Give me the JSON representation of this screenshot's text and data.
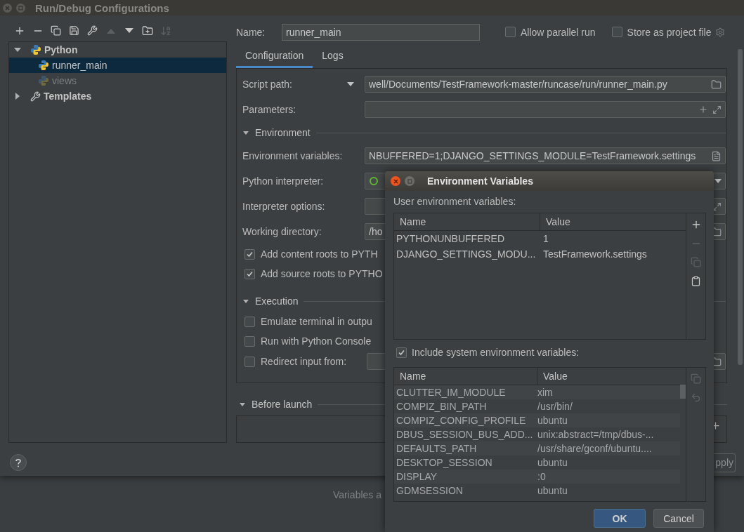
{
  "window": {
    "title": "Run/Debug Configurations"
  },
  "toolbar": [
    {
      "kind": "add",
      "disabled": false
    },
    {
      "kind": "remove",
      "disabled": false
    },
    {
      "kind": "copy",
      "disabled": false
    },
    {
      "kind": "save",
      "disabled": false
    },
    {
      "kind": "edit",
      "disabled": false
    },
    {
      "kind": "up",
      "disabled": true
    },
    {
      "kind": "down",
      "disabled": false
    },
    {
      "kind": "folder",
      "disabled": false
    },
    {
      "kind": "sort",
      "disabled": true
    }
  ],
  "tree": [
    {
      "label": "Python",
      "kind": "python",
      "expanded": true,
      "selected": false,
      "children": [
        {
          "label": "runner_main",
          "kind": "python",
          "selected": true,
          "dimmed": false
        },
        {
          "label": "views",
          "kind": "python",
          "selected": false,
          "dimmed": true
        }
      ]
    },
    {
      "label": "Templates",
      "kind": "templates",
      "expanded": false,
      "selected": false
    }
  ],
  "name_field": {
    "label": "Name:",
    "value": "runner_main"
  },
  "options": [
    {
      "label": "Allow parallel run",
      "checked": false
    },
    {
      "label": "Store as project file",
      "checked": false
    }
  ],
  "tabs": [
    {
      "label": "Configuration",
      "selected": true
    },
    {
      "label": "Logs",
      "selected": false
    }
  ],
  "config_rows": [
    {
      "kind": "path_field",
      "label": "Script path:",
      "dropdown": true,
      "value": "well/Documents/TestFramework-master/runcase/run/runner_main.py"
    },
    {
      "kind": "param_field",
      "label": "Parameters:"
    },
    {
      "kind": "section",
      "label": "Environment"
    },
    {
      "kind": "env_field",
      "label": "Environment variables:",
      "value": "NBUFFERED=1;DJANGO_SETTINGS_MODULE=TestFramework.settings"
    },
    {
      "kind": "combo",
      "label": "Python interpreter:"
    },
    {
      "kind": "options_field",
      "label": "Interpreter options:"
    },
    {
      "kind": "path_field",
      "label": "Working directory:",
      "value": "/ho"
    },
    {
      "kind": "checkbox",
      "label": "Add content roots to PYTH",
      "checked": true
    },
    {
      "kind": "checkbox",
      "label": "Add source roots to PYTHO",
      "checked": true
    },
    {
      "kind": "section",
      "label": "Execution"
    },
    {
      "kind": "checkbox",
      "label": "Emulate terminal in outpu",
      "checked": false
    },
    {
      "kind": "checkbox",
      "label": "Run with Python Console",
      "checked": false
    },
    {
      "kind": "checkbox_field",
      "label": "Redirect input from:",
      "checked": false
    }
  ],
  "before_launch": {
    "label": "Before launch"
  },
  "footer": {
    "apply_label": "pply"
  },
  "background_text": "Variables a",
  "dialog": {
    "title": "Environment Variables",
    "user_label": "User environment variables:",
    "user_columns": [
      "Name",
      "Value"
    ],
    "user_rows": [
      [
        "PYTHONUNBUFFERED",
        "1"
      ],
      [
        "DJANGO_SETTINGS_MODU...",
        "TestFramework.settings"
      ]
    ],
    "user_tools": [
      {
        "kind": "add",
        "disabled": false
      },
      {
        "kind": "remove",
        "disabled": true
      },
      {
        "kind": "copy",
        "disabled": true
      },
      {
        "kind": "paste",
        "disabled": false
      }
    ],
    "include_system": {
      "label": "Include system environment variables:",
      "checked": true
    },
    "system_columns": [
      "Name",
      "Value"
    ],
    "system_rows": [
      [
        "CLUTTER_IM_MODULE",
        "xim"
      ],
      [
        "COMPIZ_BIN_PATH",
        "/usr/bin/"
      ],
      [
        "COMPIZ_CONFIG_PROFILE",
        "ubuntu"
      ],
      [
        "DBUS_SESSION_BUS_ADD...",
        "unix:abstract=/tmp/dbus-..."
      ],
      [
        "DEFAULTS_PATH",
        "/usr/share/gconf/ubuntu...."
      ],
      [
        "DESKTOP_SESSION",
        "ubuntu"
      ],
      [
        "DISPLAY",
        ":0"
      ],
      [
        "GDMSESSION",
        "ubuntu"
      ]
    ],
    "system_tools": [
      {
        "kind": "copy",
        "disabled": true
      },
      {
        "kind": "undo",
        "disabled": true
      }
    ],
    "buttons": [
      {
        "label": "OK",
        "kind": "primary"
      },
      {
        "label": "Cancel",
        "kind": "secondary"
      }
    ]
  }
}
